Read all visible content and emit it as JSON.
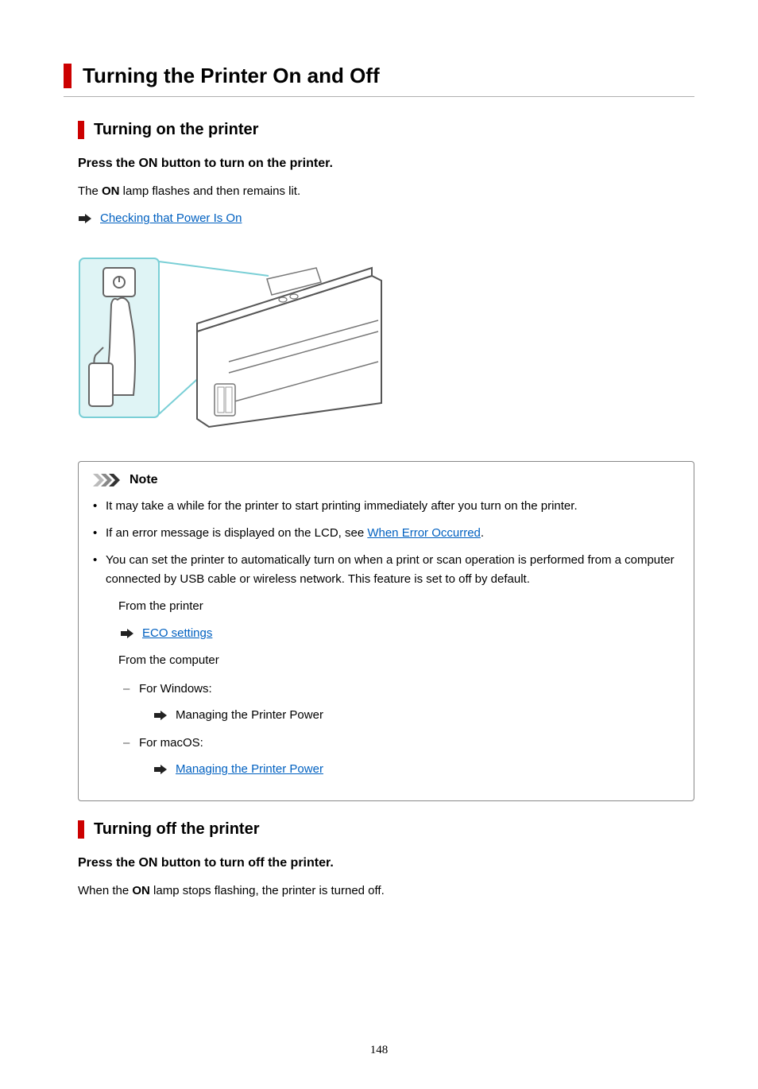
{
  "page": {
    "title": "Turning the Printer On and Off",
    "number": "148"
  },
  "section_on": {
    "heading": "Turning on the printer",
    "step": "Press the ON button to turn on the printer.",
    "lamp_prefix": "The ",
    "lamp_bold": "ON",
    "lamp_suffix": " lamp flashes and then remains lit.",
    "link_check_power": "Checking that Power Is On"
  },
  "note": {
    "label": "Note",
    "item1": "It may take a while for the printer to start printing immediately after you turn on the printer.",
    "item2_prefix": "If an error message is displayed on the LCD, see ",
    "item2_link": "When Error Occurred",
    "item2_suffix": ".",
    "item3": "You can set the printer to automatically turn on when a print or scan operation is performed from a computer connected by USB cable or wireless network. This feature is set to off by default.",
    "from_printer": "From the printer",
    "eco_link": "ECO settings",
    "from_computer": "From the computer",
    "for_windows": "For Windows:",
    "managing_win": "Managing the Printer Power",
    "for_macos": "For macOS:",
    "managing_mac": "Managing the Printer Power"
  },
  "section_off": {
    "heading": "Turning off the printer",
    "step": "Press the ON button to turn off the printer.",
    "lamp_prefix": "When the ",
    "lamp_bold": "ON",
    "lamp_suffix": " lamp stops flashing, the printer is turned off."
  }
}
